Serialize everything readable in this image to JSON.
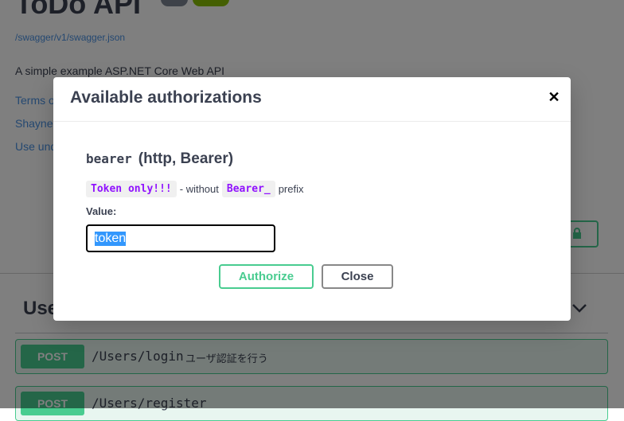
{
  "page": {
    "api_title": "ToDo API",
    "spec_link": "/swagger/v1/swagger.json",
    "description": "A simple example ASP.NET Core Web API",
    "links": [
      "Terms of service",
      "Shayne Boyer - Website",
      "Use under LICX"
    ],
    "section_title": "Users",
    "operations": [
      {
        "method": "POST",
        "path": "/Users/login",
        "summary": "ユーザ認証を行う"
      },
      {
        "method": "POST",
        "path": "/Users/register",
        "summary": ""
      }
    ]
  },
  "modal": {
    "title": "Available authorizations",
    "scheme_name": "bearer",
    "scheme_type": "(http, Bearer)",
    "desc_code1": "Token only!!!",
    "desc_text1": "- without",
    "desc_code2": "Bearer_",
    "desc_text2": "prefix",
    "value_label": "Value:",
    "token_value": "token",
    "authorize_label": "Authorize",
    "close_label": "Close"
  },
  "colors": {
    "accent": "#49cc90",
    "code": "#9012fe",
    "link": "#4990e2",
    "text": "#3b4151"
  }
}
